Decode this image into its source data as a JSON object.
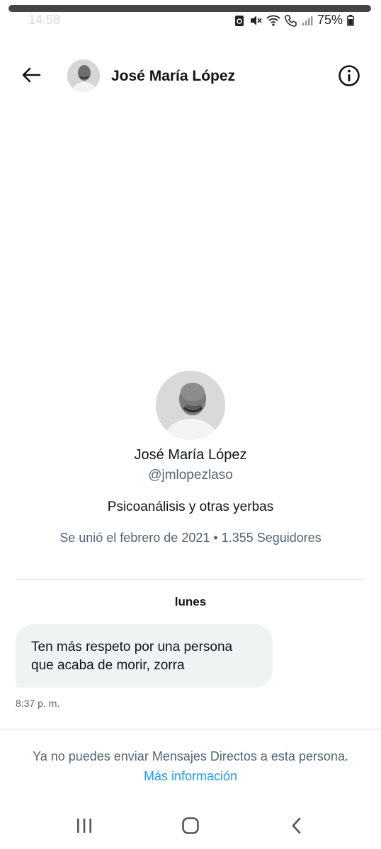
{
  "status_bar": {
    "time": "14:58",
    "battery": "75%",
    "icons": [
      "recycle-icon",
      "mute-icon",
      "wifi-icon",
      "call-icon",
      "signal-icon",
      "battery-icon"
    ]
  },
  "header": {
    "name": "José María López",
    "back_icon": "arrow-left-icon",
    "info_icon": "info-circle-icon"
  },
  "profile": {
    "name": "José María López",
    "handle": "@jmlopezlaso",
    "bio": "Psicoanálisis y otras yerbas",
    "joined": "Se unió el febrero de 2021",
    "separator": " • ",
    "followers": "1.355 Seguidores"
  },
  "conversation": {
    "day_label": "lunes",
    "messages": [
      {
        "line1": "Ten más respeto por una persona",
        "line2": "que acaba de morir, zorra",
        "time": "8:37 p. m."
      }
    ]
  },
  "footer": {
    "notice": "Ya no puedes enviar Mensajes Directos a esta persona.",
    "link": "Más información"
  },
  "colors": {
    "text_primary": "#0f1419",
    "text_secondary": "#536471",
    "link": "#1d9bf0",
    "bubble_bg": "#eff3f4",
    "divider": "#cfd9de"
  }
}
